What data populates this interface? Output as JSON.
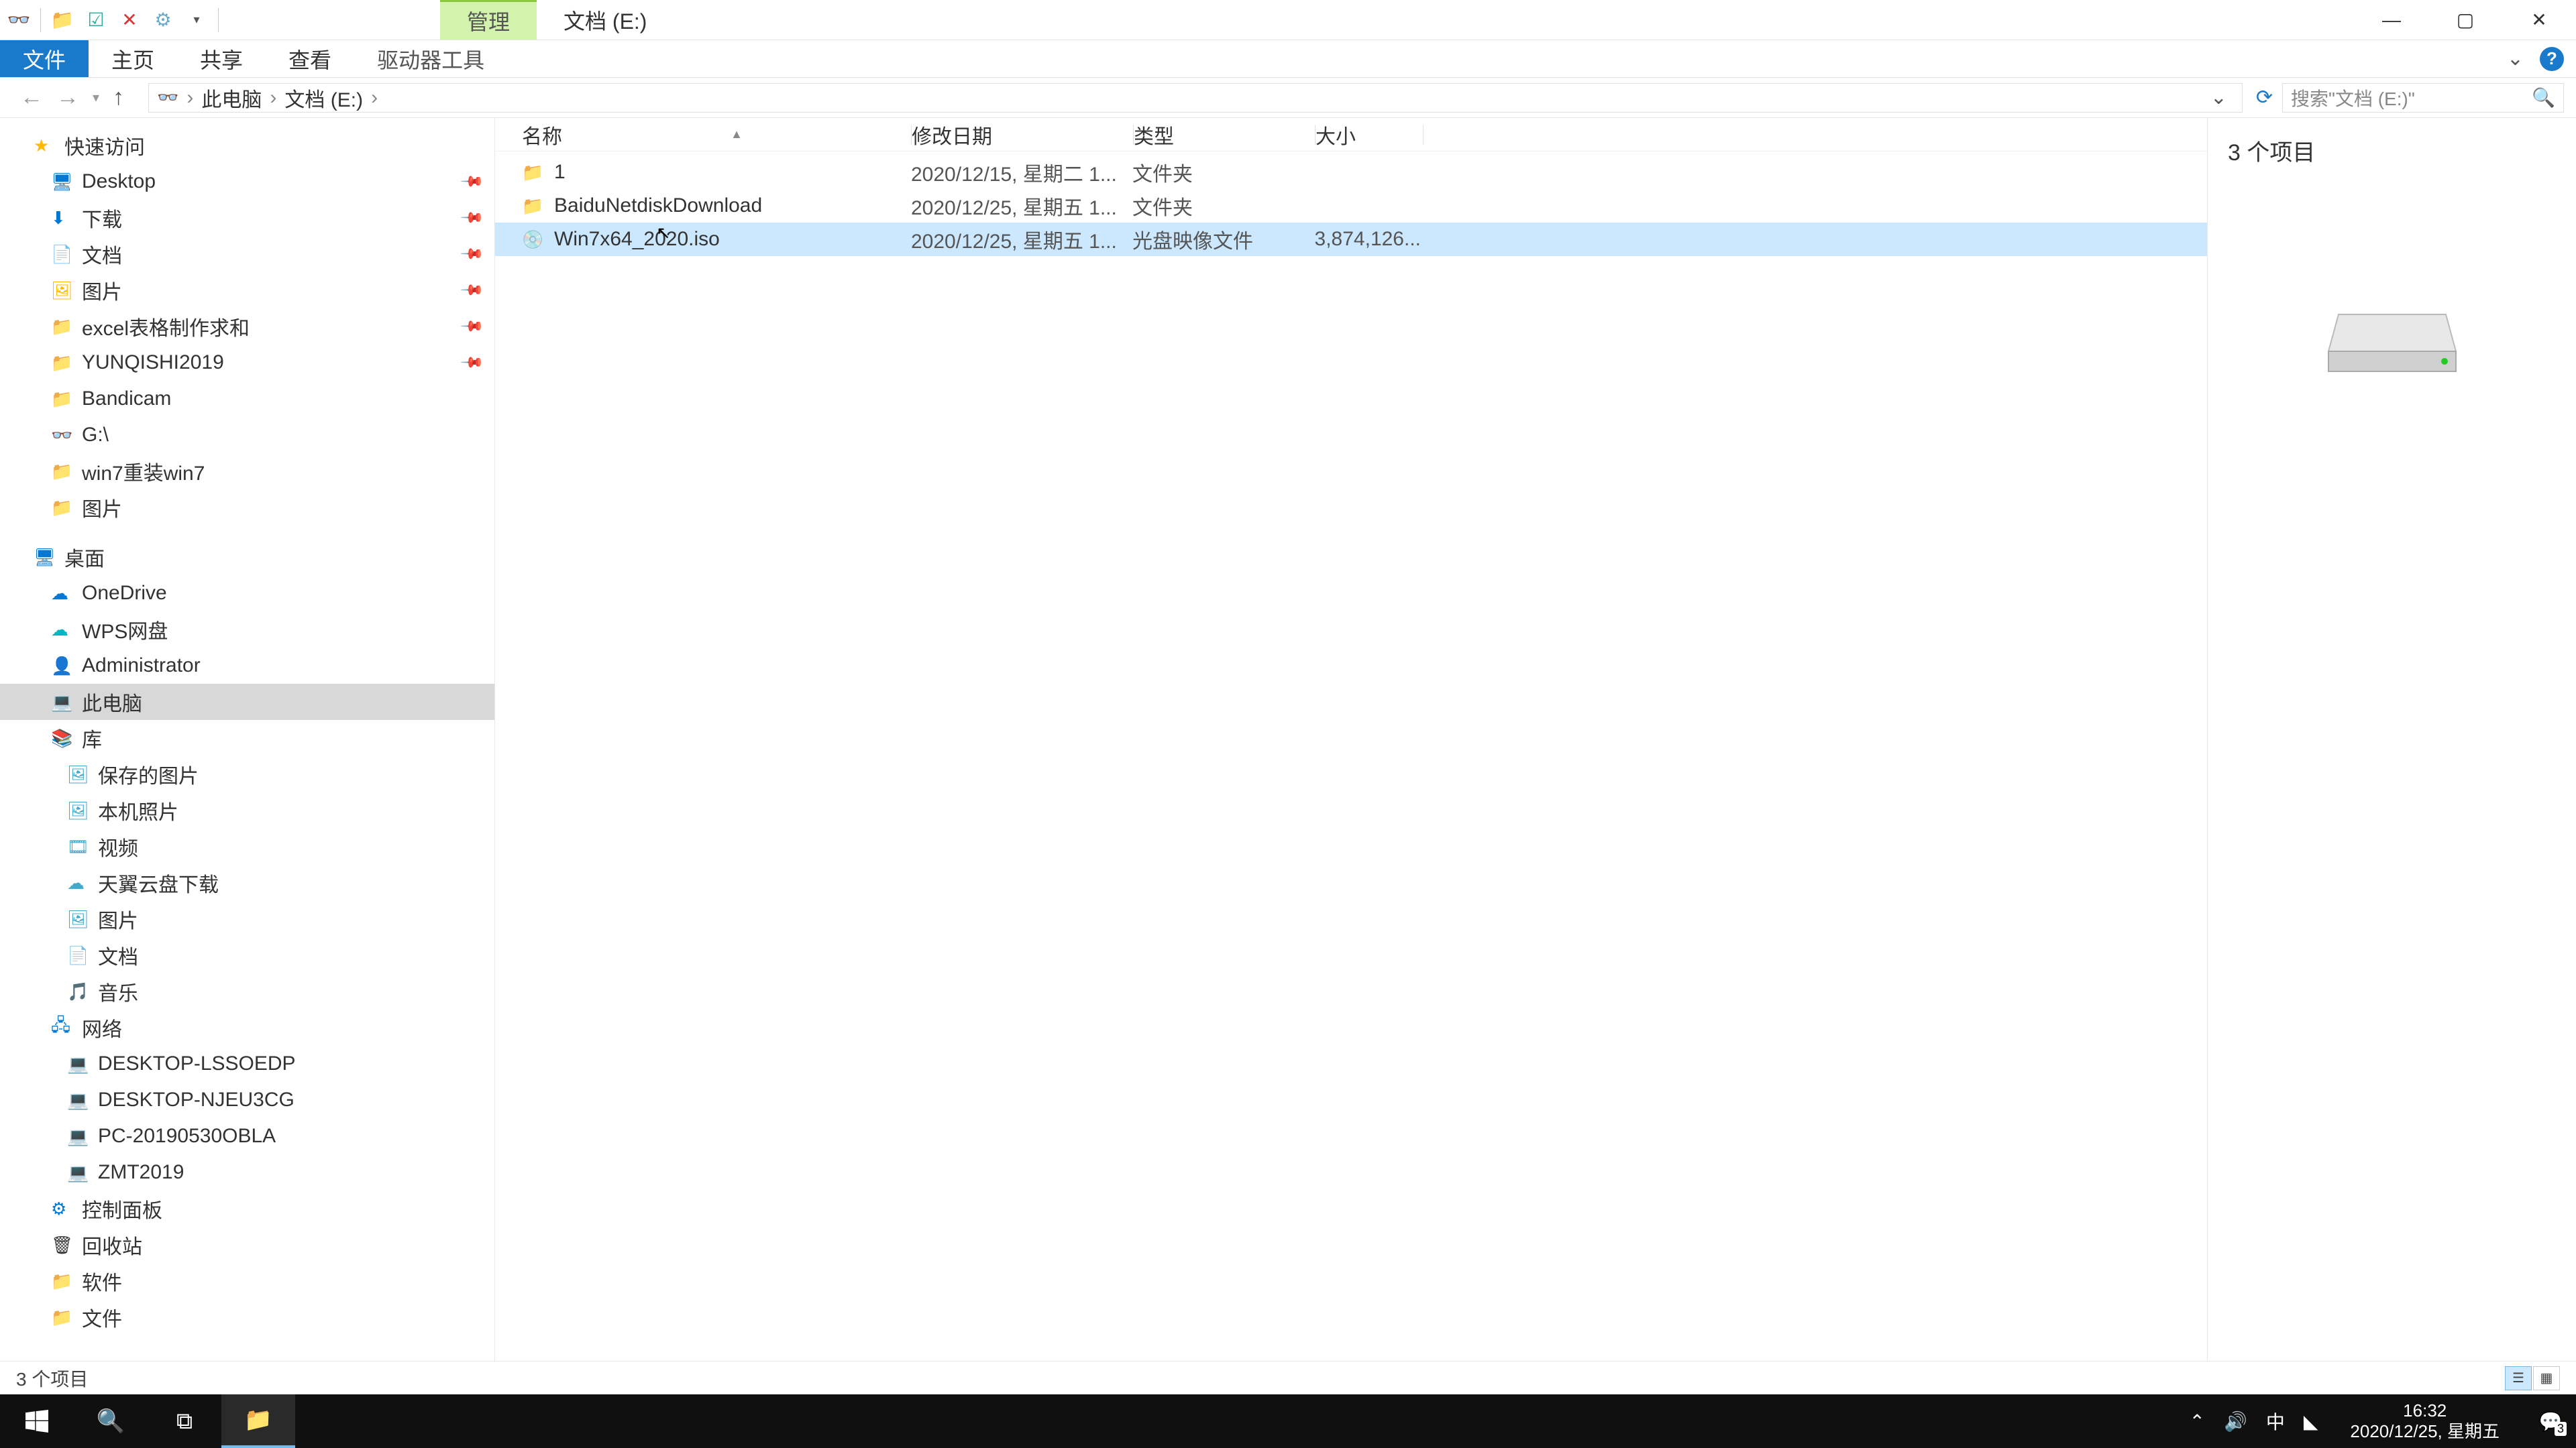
{
  "titlebar": {
    "manage_tab": "管理",
    "drive_label": "文档 (E:)"
  },
  "ribbon": {
    "file": "文件",
    "home": "主页",
    "share": "共享",
    "view": "查看",
    "drive_tools": "驱动器工具"
  },
  "breadcrumb": {
    "this_pc": "此电脑",
    "drive": "文档 (E:)"
  },
  "search": {
    "placeholder": "搜索\"文档 (E:)\""
  },
  "sidebar": {
    "quick_access": "快速访问",
    "desktop": "Desktop",
    "downloads": "下载",
    "documents": "文档",
    "pictures": "图片",
    "excel": "excel表格制作求和",
    "yunqishi": "YUNQISHI2019",
    "bandicam": "Bandicam",
    "gdrive": "G:\\",
    "win7reinstall": "win7重装win7",
    "pictures2": "图片",
    "desktop_zh": "桌面",
    "onedrive": "OneDrive",
    "wps": "WPS网盘",
    "admin": "Administrator",
    "this_pc": "此电脑",
    "libraries": "库",
    "saved_pics": "保存的图片",
    "camera_roll": "本机照片",
    "videos": "视频",
    "tianyi": "天翼云盘下载",
    "pictures3": "图片",
    "documents2": "文档",
    "music": "音乐",
    "network": "网络",
    "pc1": "DESKTOP-LSSOEDP",
    "pc2": "DESKTOP-NJEU3CG",
    "pc3": "PC-20190530OBLA",
    "pc4": "ZMT2019",
    "control_panel": "控制面板",
    "recycle": "回收站",
    "software": "软件",
    "files": "文件"
  },
  "columns": {
    "name": "名称",
    "date": "修改日期",
    "type": "类型",
    "size": "大小"
  },
  "rows": [
    {
      "name": "1",
      "date": "2020/12/15, 星期二 1...",
      "type": "文件夹",
      "size": "",
      "icon": "folder",
      "selected": false
    },
    {
      "name": "BaiduNetdiskDownload",
      "date": "2020/12/25, 星期五 1...",
      "type": "文件夹",
      "size": "",
      "icon": "folder",
      "selected": false
    },
    {
      "name": "Win7x64_2020.iso",
      "date": "2020/12/25, 星期五 1...",
      "type": "光盘映像文件",
      "size": "3,874,126...",
      "icon": "iso",
      "selected": true
    }
  ],
  "preview": {
    "count": "3 个项目"
  },
  "statusbar": {
    "count": "3 个项目"
  },
  "taskbar": {
    "time": "16:32",
    "date": "2020/12/25, 星期五",
    "ime": "中",
    "notif_count": "3"
  }
}
